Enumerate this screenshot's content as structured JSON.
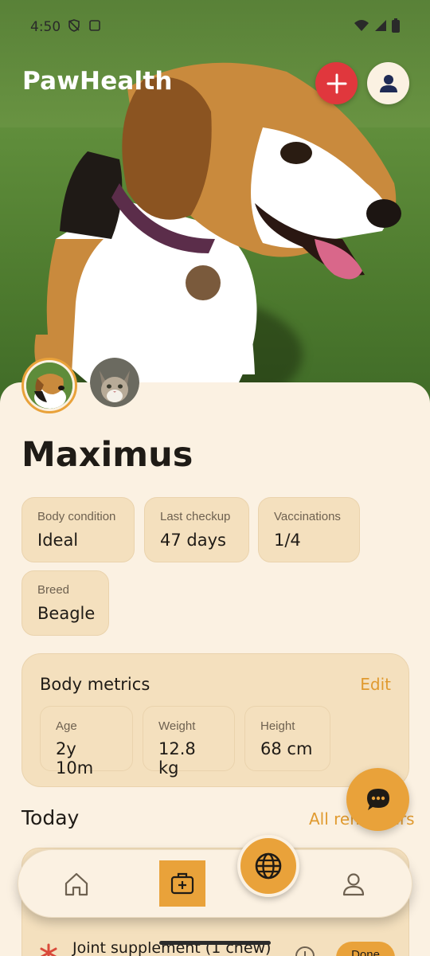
{
  "status_bar": {
    "time": "4:50"
  },
  "header": {
    "app_title": "PawHealth"
  },
  "pets": [
    {
      "name": "Maximus",
      "selected": true
    },
    {
      "name": "cat",
      "selected": false
    }
  ],
  "pet": {
    "name": "Maximus",
    "stats": [
      {
        "label": "Body condition",
        "value": "Ideal"
      },
      {
        "label": "Last checkup",
        "value": "47 days"
      },
      {
        "label": "Vaccinations",
        "value": "1/4"
      },
      {
        "label": "Breed",
        "value": "Beagle"
      }
    ]
  },
  "body_metrics": {
    "title": "Body metrics",
    "edit_label": "Edit",
    "items": [
      {
        "label": "Age",
        "value": "2y 10m"
      },
      {
        "label": "Weight",
        "value": "12.8 kg"
      },
      {
        "label": "Height",
        "value": "68 cm"
      }
    ]
  },
  "today": {
    "title": "Today",
    "all_reminders_label": "All reminders",
    "reminders": [
      {
        "title": "Joint supplement (1 chew)",
        "action": "Done"
      }
    ]
  },
  "colors": {
    "accent": "#e9a23a",
    "add_button": "#e0373d",
    "background": "#fbf1e2",
    "chip": "#f4e0be"
  },
  "icons": [
    "add-icon",
    "profile-icon",
    "chat-icon",
    "home-icon",
    "medical-kit-icon",
    "globe-icon",
    "person-icon",
    "clock-icon",
    "pill-icon"
  ]
}
